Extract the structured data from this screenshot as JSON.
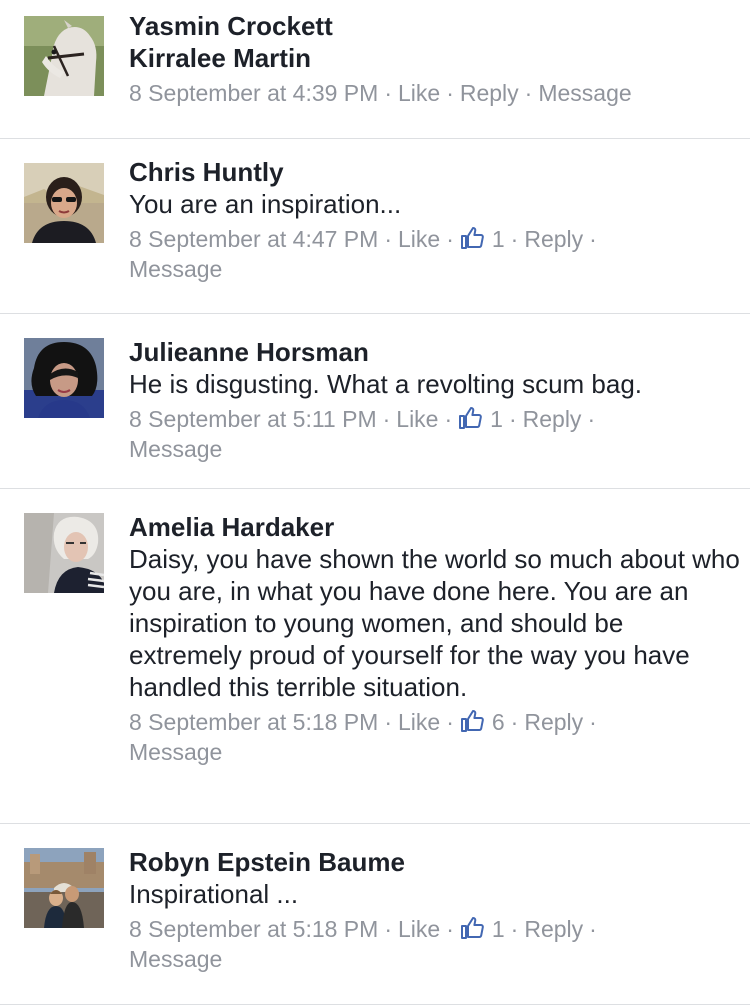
{
  "comments": [
    {
      "author": "Yasmin Crockett",
      "text": "Kirralee Martin",
      "text_is_name": true,
      "timestamp": "8 September at 4:39 PM",
      "like_label": "Like",
      "likes": null,
      "reply_label": "Reply",
      "message_label": "Message"
    },
    {
      "author": "Chris Huntly",
      "text": "You are an inspiration...",
      "timestamp": "8 September at 4:47 PM",
      "like_label": "Like",
      "likes": "1",
      "reply_label": "Reply",
      "message_label": "Message"
    },
    {
      "author": "Julieanne Horsman",
      "text": "He is disgusting. What a revolting scum bag.",
      "timestamp": "8 September at 5:11 PM",
      "like_label": "Like",
      "likes": "1",
      "reply_label": "Reply",
      "message_label": "Message"
    },
    {
      "author": "Amelia Hardaker",
      "text": "Daisy, you have shown the world so much about who you are, in what you have done here. You are an inspiration to young women, and should be extremely proud of yourself for the way you have handled this terrible situation.",
      "timestamp": "8 September at 5:18 PM",
      "like_label": "Like",
      "likes": "6",
      "reply_label": "Reply",
      "message_label": "Message"
    },
    {
      "author": "Robyn Epstein Baume",
      "text": "Inspirational ...",
      "timestamp": "8 September at 5:18 PM",
      "like_label": "Like",
      "likes": "1",
      "reply_label": "Reply",
      "message_label": "Message"
    }
  ],
  "colors": {
    "text": "#1d2129",
    "meta": "#90949c",
    "like_icon": "#4267b2",
    "divider": "#dddfe2"
  }
}
